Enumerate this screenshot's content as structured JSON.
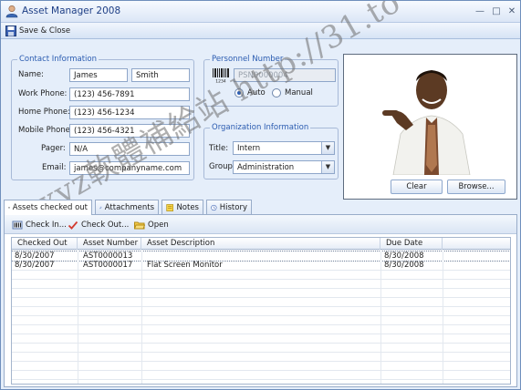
{
  "window": {
    "title": "Asset Manager 2008"
  },
  "toolbar": {
    "save_close": "Save & Close"
  },
  "contact": {
    "title": "Contact Information",
    "name_label": "Name:",
    "first_name": "James",
    "last_name": "Smith",
    "work_label": "Work Phone:",
    "work": "(123) 456-7891",
    "home_label": "Home Phone:",
    "home": "(123) 456-1234",
    "mobile_label": "Mobile Phone:",
    "mobile": "(123) 456-4321",
    "pager_label": "Pager:",
    "pager": "N/A",
    "email_label": "Email:",
    "email": "james@companyname.com"
  },
  "personnel": {
    "title": "Personnel Number",
    "number": "PSN0000004",
    "auto_label": "Auto",
    "manual_label": "Manual",
    "selected": "Auto"
  },
  "organization": {
    "title": "Organization Information",
    "title_label": "Title:",
    "title_value": "Intern",
    "group_label": "Group:",
    "group_value": "Administration"
  },
  "photo": {
    "clear_label": "Clear",
    "browse_label": "Browse..."
  },
  "tabs": [
    {
      "label": "Assets checked out",
      "active": true
    },
    {
      "label": "Attachments"
    },
    {
      "label": "Notes"
    },
    {
      "label": "History"
    }
  ],
  "subtoolbar": {
    "check_in": "Check In...",
    "check_out": "Check Out...",
    "open": "Open"
  },
  "grid": {
    "columns": [
      "Checked Out",
      "Asset Number",
      "Asset Description",
      "Due Date"
    ],
    "rows": [
      [
        "8/30/2007",
        "AST0000013",
        "",
        "8/30/2008"
      ],
      [
        "8/30/2007",
        "AST0000017",
        "Flat Screen Monitor",
        "8/30/2008"
      ]
    ]
  },
  "watermark": {
    "text": "xyz軟體補給站 http://31.to"
  },
  "colors": {
    "accent": "#2a5bb0",
    "window_bg": "#e5eefa",
    "border": "#6f8fbc"
  }
}
